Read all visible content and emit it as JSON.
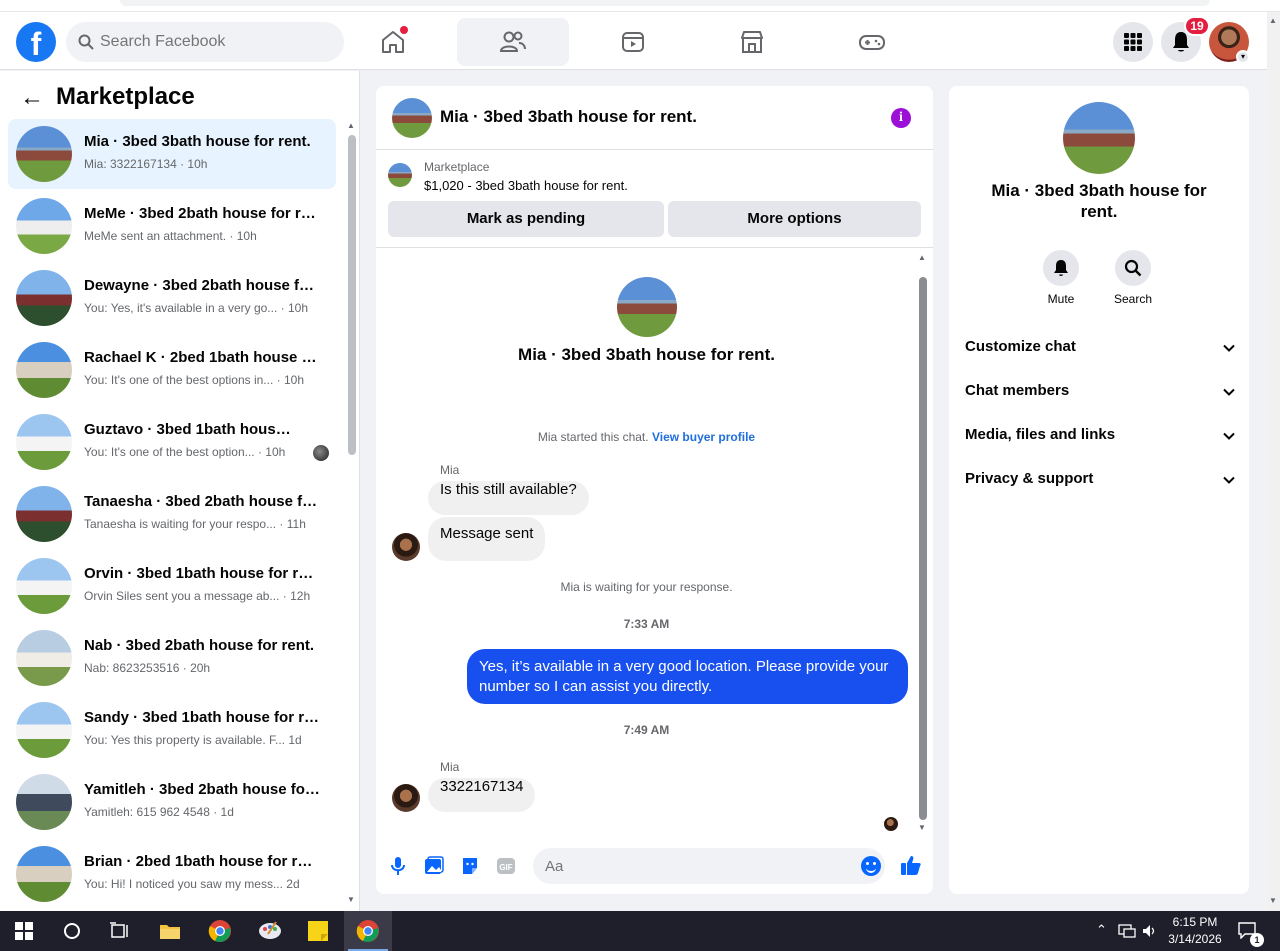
{
  "topbar": {
    "logo_letter": "f",
    "search_placeholder": "Search Facebook",
    "notification_count": "19",
    "colors": {
      "brand": "#1877f2",
      "badge": "#e41e3f"
    }
  },
  "left": {
    "heading": "Marketplace",
    "conversations": [
      {
        "title": "Mia · 3bed 3bath house for rent.",
        "sub": "Mia: 3322167134 · 10h",
        "active": true
      },
      {
        "title": "MeMe · 3bed 2bath house for re...",
        "sub": "MeMe sent an attachment. · 10h"
      },
      {
        "title": "Dewayne · 3bed 2bath house for...",
        "sub": "You: Yes, it's available in a very go...  · 10h"
      },
      {
        "title": "Rachael K · 2bed 1bath house fo...",
        "sub": "You: It's one of the best options in...  · 10h"
      },
      {
        "title": "Guztavo · 3bed 1bath house f...",
        "sub": "You: It's one of the best option...  · 10h"
      },
      {
        "title": "Tanaesha · 3bed 2bath house for...",
        "sub": "Tanaesha is waiting for your respo... · 11h"
      },
      {
        "title": "Orvin · 3bed 1bath house for rent.",
        "sub": "Orvin Siles sent you a message ab... · 12h"
      },
      {
        "title": "Nab · 3bed 2bath house for rent.",
        "sub": "Nab: 8623253516 · 20h"
      },
      {
        "title": "Sandy · 3bed 1bath house for rent.",
        "sub": "You: Yes this property is available. F...  1d"
      },
      {
        "title": "Yamitleh · 3bed 2bath house for ...",
        "sub": "Yamitleh: 615 962 4548 · 1d"
      },
      {
        "title": "Brian · 2bed 1bath house for rent.",
        "sub": "You: Hi! I noticed you saw my mess...  2d"
      }
    ]
  },
  "chat": {
    "title": "Mia · 3bed 3bath house for rent.",
    "listing_label": "Marketplace",
    "listing_price": "$1,020 - 3bed 3bath house for rent.",
    "btn_pending": "Mark as pending",
    "btn_more": "More options",
    "thread_name": "Mia · 3bed 3bath house for rent.",
    "started_text": "Mia started this chat.",
    "view_profile": "View buyer profile",
    "sender_1": "Mia",
    "msg_1": "Is this still available?",
    "msg_2": "Message sent",
    "waiting": "Mia is waiting for your response.",
    "time_1": "7:33 AM",
    "msg_out": "Yes, it’s available in a very good location. Please provide your number so I can assist you directly.",
    "time_2": "7:49 AM",
    "sender_2": "Mia",
    "msg_3": "3322167134",
    "composer_placeholder": "Aa",
    "colors": {
      "outgoing": "#1850ef",
      "accent": "#0866ff",
      "info": "#9b0fd6"
    }
  },
  "info": {
    "title": "Mia · 3bed 3bath house for rent.",
    "mute_label": "Mute",
    "search_label": "Search",
    "sections": [
      "Customize chat",
      "Chat members",
      "Media, files and links",
      "Privacy & support"
    ]
  },
  "taskbar": {
    "time": "6:15 PM",
    "date": "3/14/2026",
    "notification_count": "1"
  }
}
